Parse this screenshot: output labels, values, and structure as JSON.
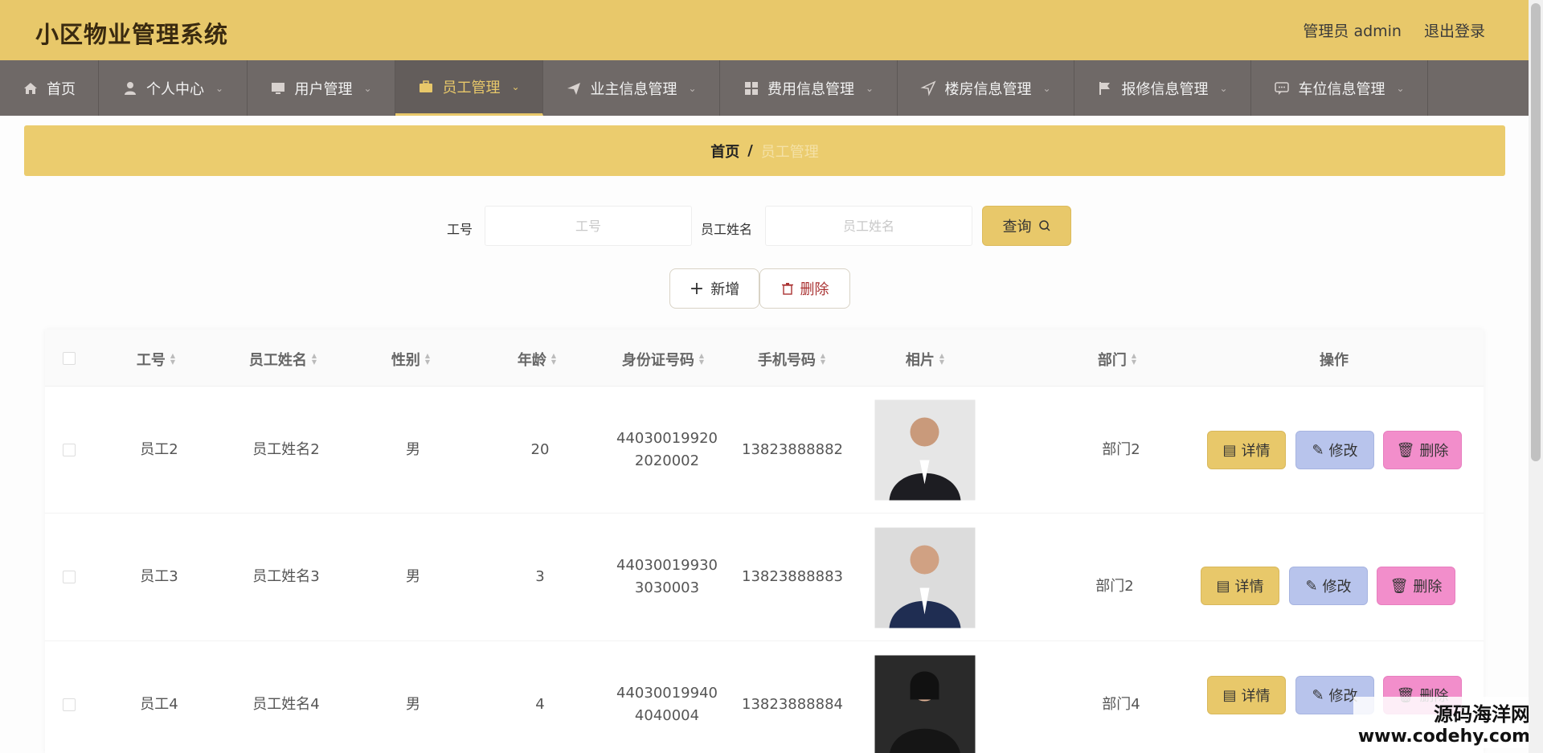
{
  "header": {
    "title": "小区物业管理系统",
    "user_label": "管理员 admin",
    "logout_label": "退出登录"
  },
  "nav": {
    "items": [
      {
        "label": "首页",
        "icon": "home-icon"
      },
      {
        "label": "个人中心",
        "icon": "user-icon"
      },
      {
        "label": "用户管理",
        "icon": "monitor-icon"
      },
      {
        "label": "员工管理",
        "icon": "briefcase-icon"
      },
      {
        "label": "业主信息管理",
        "icon": "paper-plane-icon"
      },
      {
        "label": "费用信息管理",
        "icon": "grid-icon"
      },
      {
        "label": "楼房信息管理",
        "icon": "navigation-icon"
      },
      {
        "label": "报修信息管理",
        "icon": "flag-icon"
      },
      {
        "label": "车位信息管理",
        "icon": "chat-icon"
      }
    ],
    "active_index": 3
  },
  "breadcrumb": {
    "home": "首页",
    "separator": "/",
    "current": "员工管理"
  },
  "search": {
    "field1_label": "工号",
    "field1_placeholder": "工号",
    "field2_label": "员工姓名",
    "field2_placeholder": "员工姓名",
    "query_label": "查询"
  },
  "actions": {
    "add_label": "新增",
    "delete_label": "删除"
  },
  "table": {
    "columns": [
      "工号",
      "员工姓名",
      "性别",
      "年龄",
      "身份证号码",
      "手机号码",
      "相片",
      "部门",
      "操作"
    ],
    "rows": [
      {
        "id": "员工2",
        "name": "员工姓名2",
        "gender": "男",
        "age": "20",
        "idcard_1": "44030019920",
        "idcard_2": "2020002",
        "phone": "13823888882",
        "dept": "部门2"
      },
      {
        "id": "员工3",
        "name": "员工姓名3",
        "gender": "男",
        "age": "3",
        "idcard_1": "44030019930",
        "idcard_2": "3030003",
        "phone": "13823888883",
        "dept": "部门2"
      },
      {
        "id": "员工4",
        "name": "员工姓名4",
        "gender": "男",
        "age": "4",
        "idcard_1": "44030019940",
        "idcard_2": "4040004",
        "phone": "13823888884",
        "dept": "部门4"
      }
    ],
    "op_detail": "详情",
    "op_edit": "修改",
    "op_delete": "删除"
  },
  "watermark": {
    "cn": "源码海洋网",
    "en": "www.codehy.com"
  },
  "colors": {
    "accent": "#e8c86a",
    "nav_bg": "#6f6967",
    "edit_btn": "#b8c4ec",
    "delete_btn": "#f28ecb"
  }
}
